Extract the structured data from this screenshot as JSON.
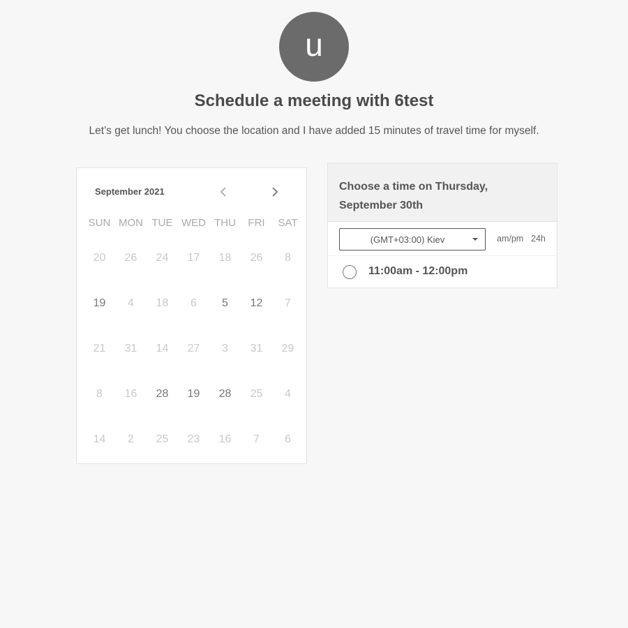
{
  "host": {
    "avatar_initial": "u"
  },
  "header": {
    "title": "Schedule a meeting with 6test",
    "description": "Let’s get lunch! You choose the location and I have added 15 minutes of travel time for myself."
  },
  "calendar": {
    "month_label": "September 2021",
    "prev_icon": "chevron-left-icon",
    "next_icon": "chevron-right-icon",
    "weekdays": [
      "SUN",
      "MON",
      "TUE",
      "WED",
      "THU",
      "FRI",
      "SAT"
    ],
    "weeks": [
      [
        {
          "label": "20",
          "available": false
        },
        {
          "label": "26",
          "available": false
        },
        {
          "label": "24",
          "available": false
        },
        {
          "label": "17",
          "available": false
        },
        {
          "label": "18",
          "available": false
        },
        {
          "label": "26",
          "available": false
        },
        {
          "label": "8",
          "available": false
        }
      ],
      [
        {
          "label": "19",
          "available": true
        },
        {
          "label": "4",
          "available": false
        },
        {
          "label": "18",
          "available": false
        },
        {
          "label": "6",
          "available": false
        },
        {
          "label": "5",
          "available": true
        },
        {
          "label": "12",
          "available": true
        },
        {
          "label": "7",
          "available": false
        }
      ],
      [
        {
          "label": "21",
          "available": false
        },
        {
          "label": "31",
          "available": false
        },
        {
          "label": "14",
          "available": false
        },
        {
          "label": "27",
          "available": false
        },
        {
          "label": "3",
          "available": false
        },
        {
          "label": "31",
          "available": false
        },
        {
          "label": "29",
          "available": false
        }
      ],
      [
        {
          "label": "8",
          "available": false
        },
        {
          "label": "16",
          "available": false
        },
        {
          "label": "28",
          "available": true
        },
        {
          "label": "19",
          "available": true
        },
        {
          "label": "28",
          "available": true
        },
        {
          "label": "25",
          "available": false
        },
        {
          "label": "4",
          "available": false
        }
      ],
      [
        {
          "label": "14",
          "available": false
        },
        {
          "label": "2",
          "available": false
        },
        {
          "label": "25",
          "available": false
        },
        {
          "label": "23",
          "available": false
        },
        {
          "label": "16",
          "available": false
        },
        {
          "label": "7",
          "available": false
        },
        {
          "label": "6",
          "available": false
        }
      ]
    ]
  },
  "times": {
    "heading_line1": "Choose a time on Thursday,",
    "heading_line2": "September 30th",
    "timezone_value": "(GMT+03:00) Kiev",
    "format_ampm": "am/pm",
    "format_24h": "24h",
    "slots": [
      {
        "label": "11:00am - 12:00pm"
      }
    ]
  }
}
